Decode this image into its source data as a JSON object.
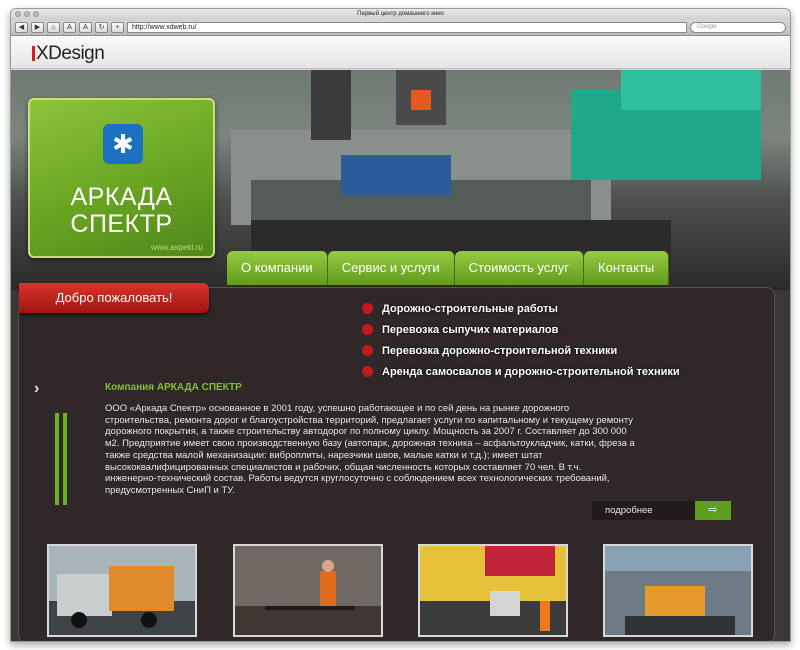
{
  "browser": {
    "title": "Первый центр домашнего кино",
    "url": "http://www.xdweb.ru/",
    "search_placeholder": "Google"
  },
  "header": {
    "logo": "XDesign"
  },
  "brand": {
    "name_line1": "АРКАДА",
    "name_line2": "СПЕКТР",
    "site": "www.aspekt.ru"
  },
  "nav": {
    "items": [
      "О компании",
      "Сервис и услуги",
      "Стоимость услуг",
      "Контакты"
    ]
  },
  "welcome": "Добро пожаловать!",
  "services": [
    "Дорожно-строительные работы",
    "Перевозка сыпучих материалов",
    "Перевозка дорожно-строительной техники",
    "Аренда самосвалов и дорожно-строительной техники"
  ],
  "company": {
    "title": "Компания АРКАДА СПЕКТР",
    "text": "ООО «Аркада Спектр» основанное в 2001 году, успешно работающее и по сей день на рынке дорожного строительства, ремонта дорог и благоустройства территорий, предлагает услуги по капитальному и текущему ремонту дорожного покрытия, а также строительству автодорог по полному циклу. Мощность за 2007 г. Составляет до 300 000 м2. Предприятие имеет свою производственную базу (автопарк, дорожная техника – асфальтоукладчик, катки, фреза а также средства малой механизации: виброплиты, нарезчики швов, малые катки и т.д.); имеет штат высококвалифицированных специалистов и рабочих, общая численность которых составляет 70 чел. В т.ч. инженерно-технический состав. Работы ведутся круглосуточно с соблюдением всех технологических требований, предусмотренных СниП и ТУ."
  },
  "more": {
    "label": "подробнее"
  }
}
